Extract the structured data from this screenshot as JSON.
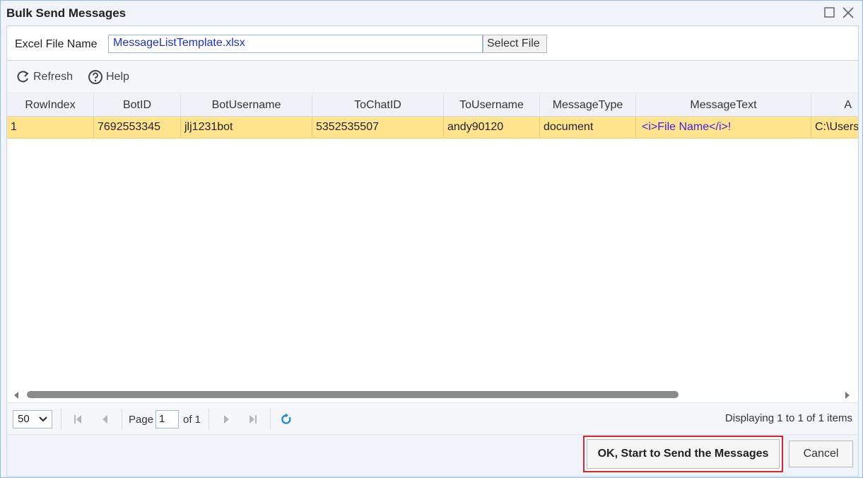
{
  "window": {
    "title": "Bulk Send Messages"
  },
  "file": {
    "label": "Excel File Name",
    "value": "MessageListTemplate.xlsx",
    "select_label": "Select File"
  },
  "toolbar": {
    "refresh_label": "Refresh",
    "help_label": "Help"
  },
  "grid": {
    "columns": [
      "RowIndex",
      "BotID",
      "BotUsername",
      "ToChatID",
      "ToUsername",
      "MessageType",
      "MessageText",
      "A"
    ],
    "rows": [
      {
        "RowIndex": "1",
        "BotID": "7692553345",
        "BotUsername": "jlj1231bot",
        "ToChatID": "5352535507",
        "ToUsername": "andy90120",
        "MessageType": "document",
        "MessageText": "<i>File Name</i>!",
        "Attachment": "C:\\Users"
      }
    ]
  },
  "pager": {
    "page_size": "50",
    "page_label": "Page",
    "page_value": "1",
    "of_label": "of 1",
    "display_info": "Displaying 1 to 1 of 1 items"
  },
  "footer": {
    "ok_label": "OK, Start to Send the Messages",
    "cancel_label": "Cancel"
  },
  "colors": {
    "selected_row": "#ffe48d",
    "highlight_border": "#e0242f",
    "link_blue": "#3a1fe0"
  }
}
